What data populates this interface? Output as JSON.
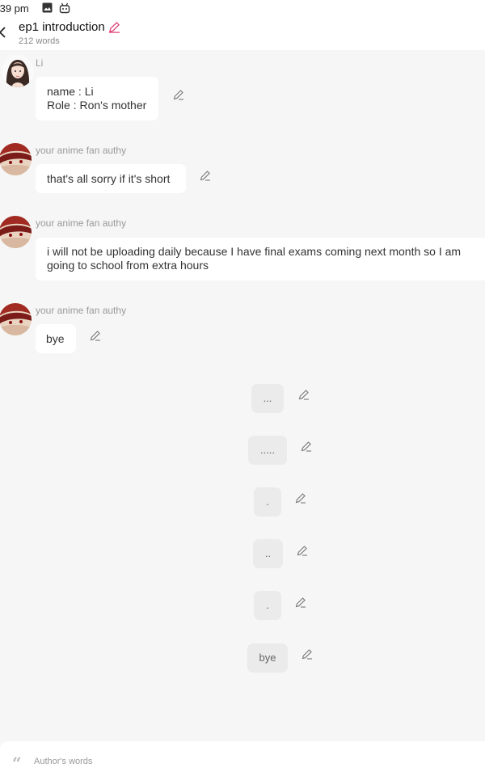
{
  "status": {
    "time": ":39 pm",
    "icons": [
      "image-icon",
      "android-icon"
    ]
  },
  "header": {
    "title": "ep1 introduction",
    "word_count": "212 words"
  },
  "messages": [
    {
      "name": "Li",
      "lines": [
        "name : Li",
        "Role : Ron's mother"
      ]
    },
    {
      "name": "your anime fan authy",
      "text": "that's all sorry if it's short"
    },
    {
      "name": "your anime fan authy",
      "text": "i will not be uploading daily because I have final exams coming next month so I am going to school from extra hours"
    },
    {
      "name": "your anime fan authy",
      "text": "bye"
    }
  ],
  "narration": [
    "...",
    ".....",
    ".",
    "..",
    ".",
    "bye"
  ],
  "footer": {
    "label": "Author's words"
  },
  "colors": {
    "accent": "#e0457b",
    "bubble": "#ffffff",
    "narration_bubble": "#ebebeb"
  }
}
